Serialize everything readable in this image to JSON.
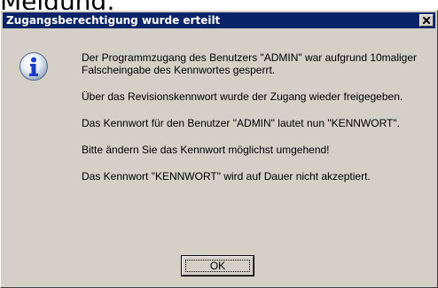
{
  "page": {
    "caption": "Meldung:"
  },
  "dialog": {
    "title": "Zugangsberechtigung wurde erteilt",
    "icon": "information-icon",
    "paragraphs": [
      "Der Programmzugang des Benutzers \"ADMIN\" war aufgrund 10maliger Falscheingabe des Kennwortes gesperrt.",
      "Über das Revisionskennwort wurde der Zugang wieder freigegeben.",
      "Das Kennwort für den Benutzer \"ADMIN\" lautet nun \"KENNWORT\".",
      "Bitte ändern Sie das Kennwort möglichst umgehend!",
      "Das Kennwort \"KENNWORT\" wird auf Dauer nicht akzeptiert."
    ],
    "ok_label": "OK",
    "colors": {
      "titlebar": "#0a246a",
      "face": "#d4d0c8"
    }
  }
}
